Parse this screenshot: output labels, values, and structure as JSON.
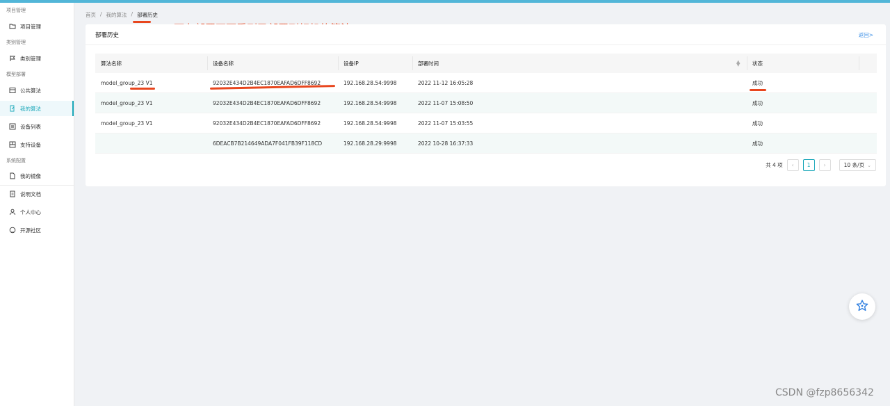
{
  "sidebar": {
    "sections": [
      "项目管理",
      "类别管理",
      "模型部署",
      "系统配置"
    ],
    "items": [
      {
        "label": "项目管理",
        "icon": "folder-icon"
      },
      {
        "label": "类别管理",
        "icon": "flag-icon"
      },
      {
        "label": "公共算法",
        "icon": "box-icon"
      },
      {
        "label": "我的算法",
        "icon": "edit-doc-icon"
      },
      {
        "label": "设备列表",
        "icon": "list-icon"
      },
      {
        "label": "支持设备",
        "icon": "device-icon"
      },
      {
        "label": "我的镜像",
        "icon": "file-icon"
      },
      {
        "label": "说明文档",
        "icon": "doc-icon"
      },
      {
        "label": "个人中心",
        "icon": "user-icon"
      },
      {
        "label": "开源社区",
        "icon": "github-icon"
      }
    ]
  },
  "breadcrumb": {
    "home": "首页",
    "mid": "我的算法",
    "current": "部署历史",
    "sep": "/"
  },
  "annotation": "可在部署页面看到已部署到相机的算法",
  "card": {
    "title": "部署历史",
    "back": "返回>"
  },
  "table": {
    "headers": [
      "算法名称",
      "设备名称",
      "设备IP",
      "部署时间",
      "状态"
    ],
    "rows": [
      [
        "model_group_23 V1",
        "92032E434D2B4EC1870EAFAD6DFF8692",
        "192.168.28.54:9998",
        "2022 11-12 16:05:28",
        "成功"
      ],
      [
        "model_group_23 V1",
        "92032E434D2B4EC1870EAFAD6DFF8692",
        "192.168.28.54:9998",
        "2022 11-07 15:08:50",
        "成功"
      ],
      [
        "model_group_23 V1",
        "92032E434D2B4EC1870EAFAD6DFF8692",
        "192.168.28.54:9998",
        "2022 11-07 15:03:55",
        "成功"
      ],
      [
        "",
        "6DEACB7B214649ADA7F041FB39F118CD",
        "192.168.28.29:9998",
        "2022 10-28 16:37:33",
        "成功"
      ]
    ]
  },
  "pagination": {
    "total": "共 4 项",
    "page": "1",
    "prev": "‹",
    "next": "›",
    "size": "10 条/页"
  },
  "watermark": "CSDN @fzp8656342",
  "colors": {
    "accent": "#1aa7b9",
    "annotation": "#e8461e",
    "link": "#3a8ee6"
  }
}
